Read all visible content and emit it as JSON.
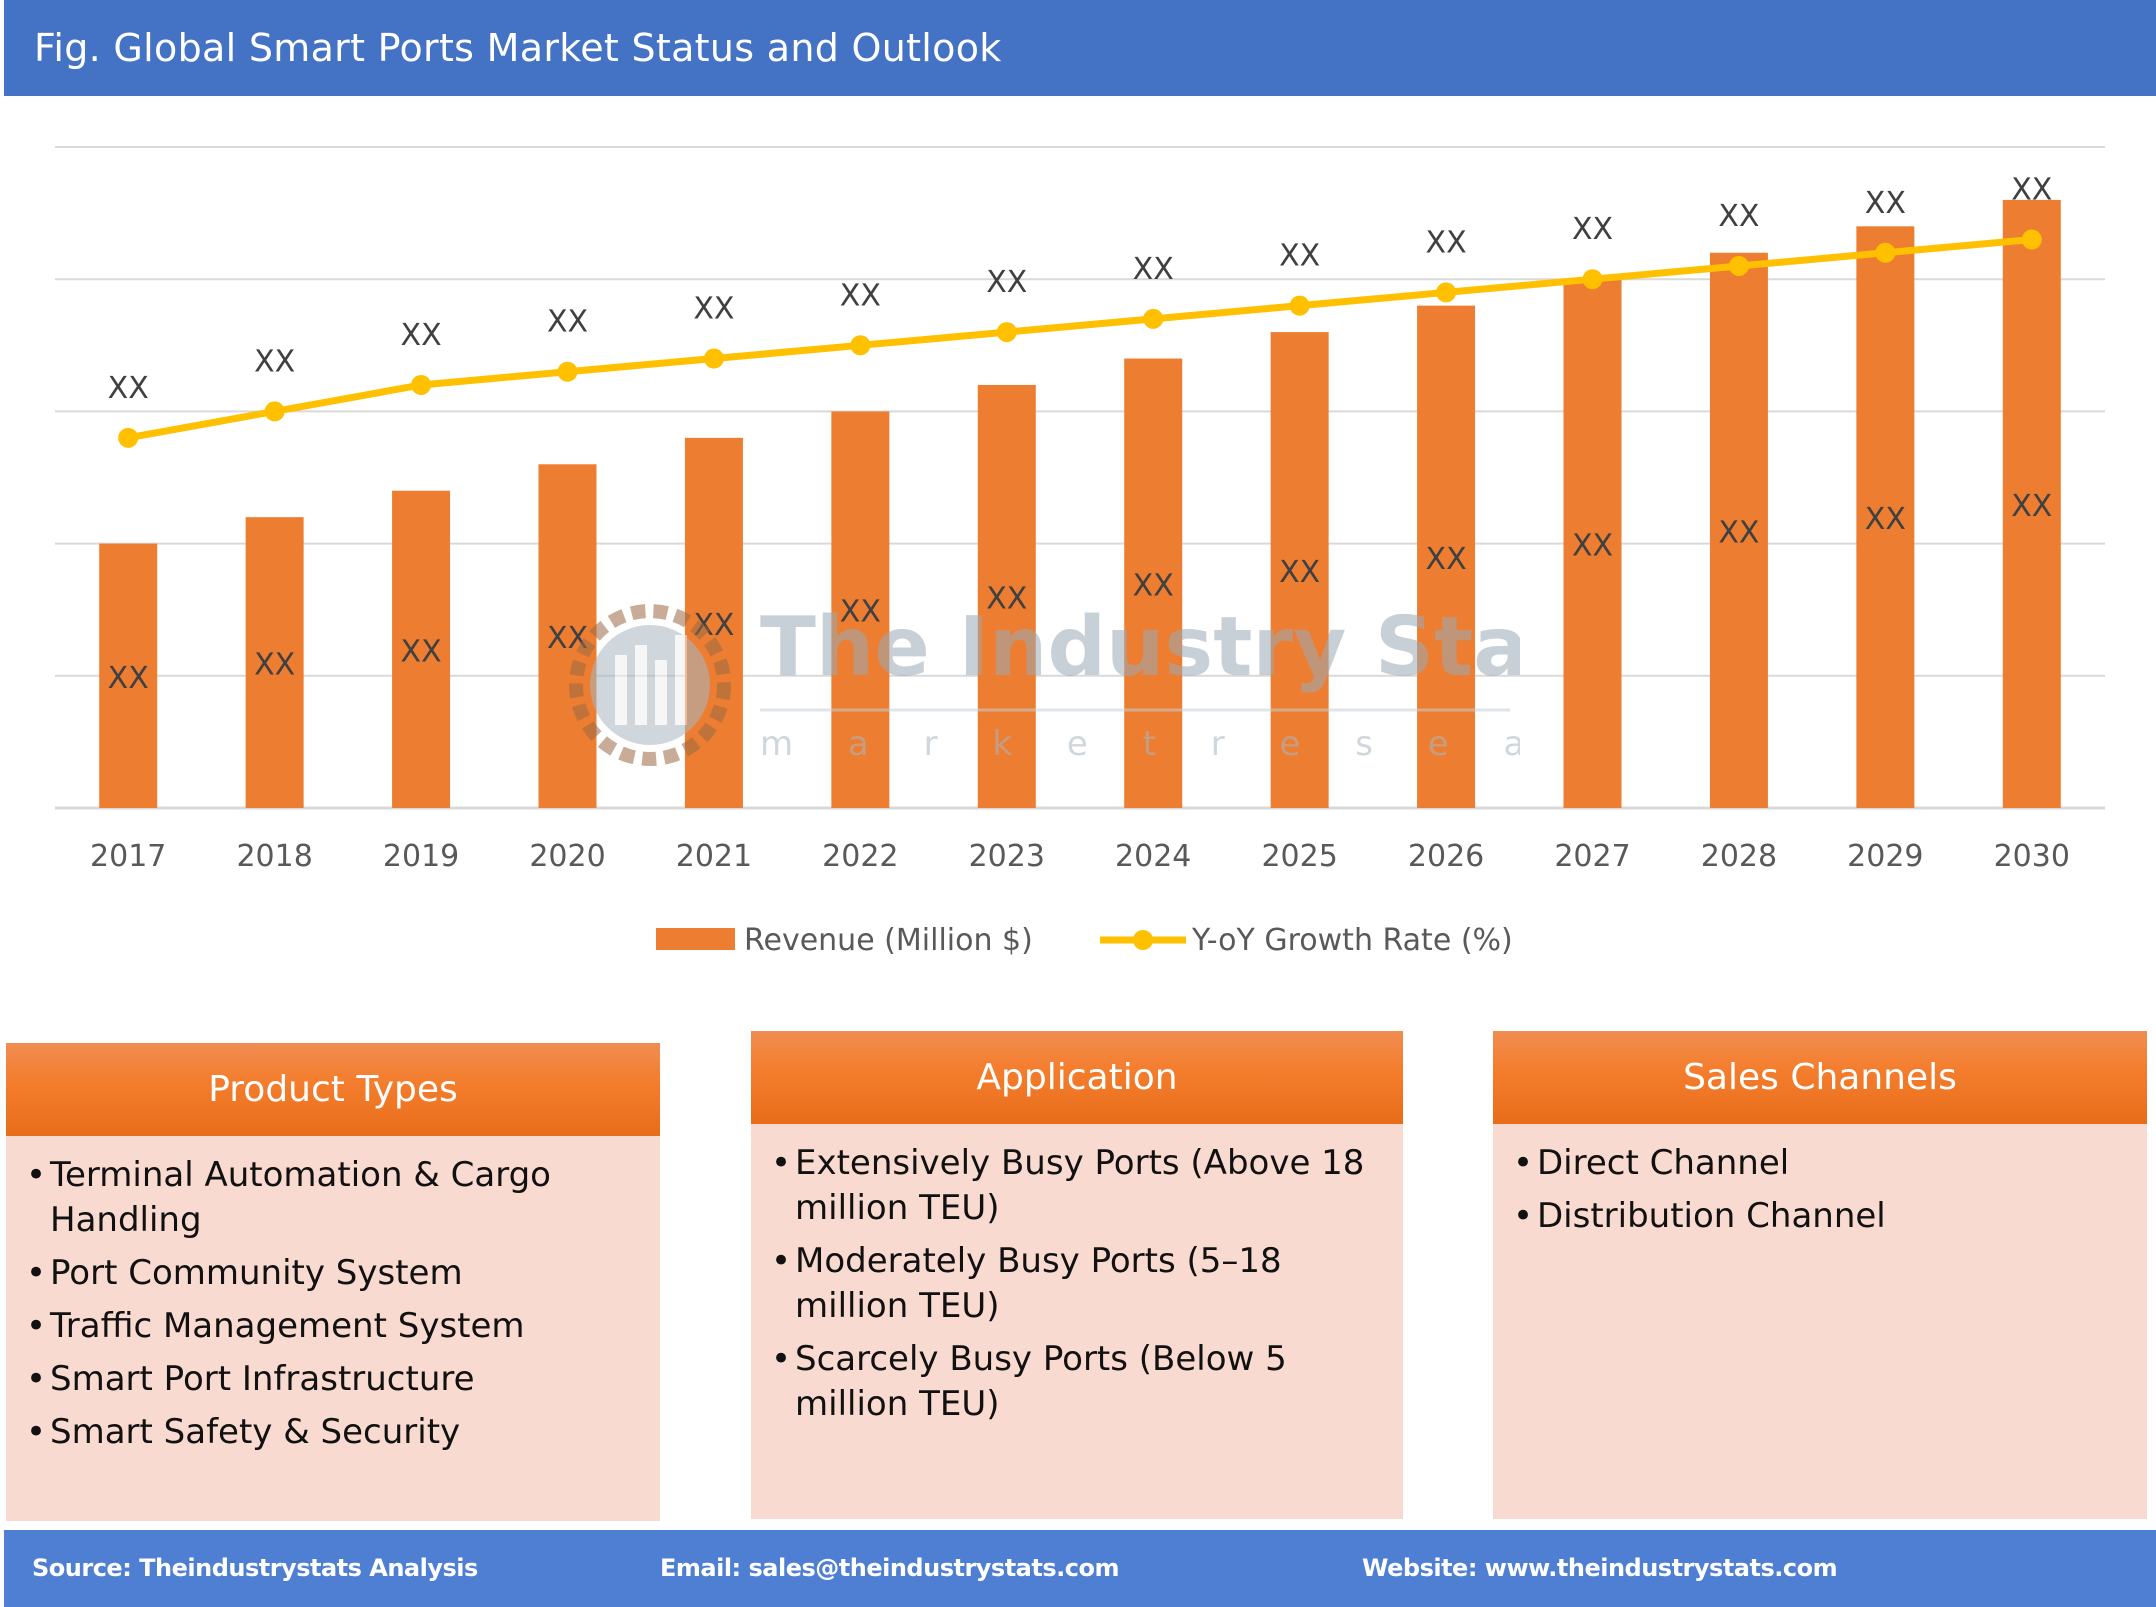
{
  "header": {
    "title": "Fig. Global Smart Ports Market Status and Outlook"
  },
  "chart_data": {
    "type": "bar",
    "title": "Fig. Global Smart Ports Market Status and Outlook",
    "xlabel": "",
    "ylabel": "",
    "categories": [
      "2017",
      "2018",
      "2019",
      "2020",
      "2021",
      "2022",
      "2023",
      "2024",
      "2025",
      "2026",
      "2027",
      "2028",
      "2029",
      "2030"
    ],
    "series": [
      {
        "name": "Revenue (Million $)",
        "type": "bar",
        "color": "#ed7d31",
        "values": [
          2.0,
          2.2,
          2.4,
          2.6,
          2.8,
          3.0,
          3.2,
          3.4,
          3.6,
          3.8,
          4.0,
          4.2,
          4.4,
          4.6
        ],
        "labels": [
          "XX",
          "XX",
          "XX",
          "XX",
          "XX",
          "XX",
          "XX",
          "XX",
          "XX",
          "XX",
          "XX",
          "XX",
          "XX",
          "XX"
        ]
      },
      {
        "name": "Y-oY Growth Rate (%)",
        "type": "line",
        "color": "#ffc000",
        "values": [
          2.8,
          3.0,
          3.2,
          3.3,
          3.4,
          3.5,
          3.6,
          3.7,
          3.8,
          3.9,
          4.0,
          4.1,
          4.2,
          4.3
        ],
        "labels": [
          "XX",
          "XX",
          "XX",
          "XX",
          "XX",
          "XX",
          "XX",
          "XX",
          "XX",
          "XX",
          "XX",
          "XX",
          "XX",
          "XX"
        ]
      }
    ],
    "value_note": "Actual values hidden (data labels show XX); values are relative units estimated from gridlines",
    "ylim": [
      0,
      5
    ],
    "grid": true,
    "y_tick_labels_visible": false,
    "legend": {
      "placement": "bottom-center",
      "entries": [
        "Revenue (Million $)",
        "Y-oY Growth Rate (%)"
      ]
    }
  },
  "watermark": {
    "brand": "The Industry Stats",
    "tagline": "m a r k e t   r e s e a r c h"
  },
  "panels": [
    {
      "title": "Product Types",
      "items": [
        "Terminal Automation & Cargo Handling",
        "Port Community System",
        "Traffic Management System",
        "Smart Port Infrastructure",
        "Smart Safety & Security"
      ]
    },
    {
      "title": "Application",
      "items": [
        "Extensively Busy Ports (Above 18 million TEU)",
        "Moderately Busy Ports (5–18 million TEU)",
        "Scarcely Busy Ports (Below 5 million TEU)"
      ]
    },
    {
      "title": "Sales Channels",
      "items": [
        "Direct Channel",
        "Distribution Channel"
      ]
    }
  ],
  "footer": {
    "source": "Source: Theindustrystats Analysis",
    "email": "Email: sales@theindustrystats.com",
    "website": "Website: www.theindustrystats.com"
  },
  "bullet_char": "•"
}
